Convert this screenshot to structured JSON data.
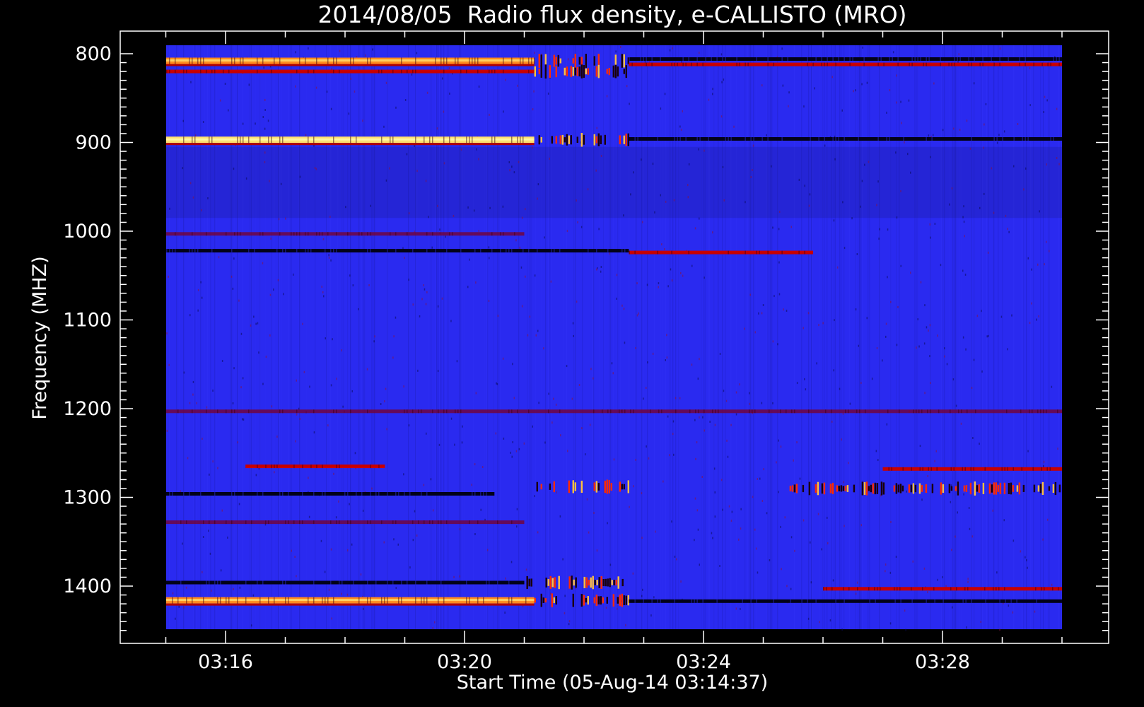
{
  "chart_data": {
    "type": "heatmap",
    "title": "2014/08/05  Radio flux density, e-CALLISTO (MRO)",
    "xlabel": "Start Time (05-Aug-14 03:14:37)",
    "ylabel": "Frequency (MHZ)",
    "x_axis": {
      "unit": "UT time",
      "range": [
        "03:14:37",
        "03:30:00"
      ],
      "major_ticks": [
        "03:16",
        "03:20",
        "03:24",
        "03:28"
      ],
      "minor_tick_step_minutes": 1
    },
    "y_axis": {
      "unit": "MHz",
      "range": [
        1450,
        795
      ],
      "inverted": true,
      "major_ticks": [
        "800",
        "900",
        "1000",
        "1100",
        "1200",
        "1300",
        "1400"
      ],
      "minor_tick_step": 10
    },
    "background_intensity": "low (blue)",
    "colormap": [
      "#000000",
      "#4a0010",
      "#b40000",
      "#ff3000",
      "#ff9a20",
      "#ffe070",
      "#2a2af0"
    ],
    "bands": [
      {
        "freq_mhz": 808,
        "t_start": "03:14:37",
        "t_end": "03:21:10",
        "level": 3
      },
      {
        "freq_mhz": 808,
        "t_start": "03:21:10",
        "t_end": "03:22:45",
        "level": 2
      },
      {
        "freq_mhz": 806,
        "t_start": "03:22:45",
        "t_end": "03:30:00",
        "level": -1
      },
      {
        "freq_mhz": 820,
        "t_start": "03:14:37",
        "t_end": "03:21:10",
        "level": 1
      },
      {
        "freq_mhz": 820,
        "t_start": "03:21:10",
        "t_end": "03:22:45",
        "level": 2
      },
      {
        "freq_mhz": 812,
        "t_start": "03:22:45",
        "t_end": "03:30:00",
        "level": 1
      },
      {
        "freq_mhz": 897,
        "t_start": "03:14:37",
        "t_end": "03:21:10",
        "level": 4
      },
      {
        "freq_mhz": 897,
        "t_start": "03:21:10",
        "t_end": "03:22:45",
        "level": 2
      },
      {
        "freq_mhz": 896,
        "t_start": "03:22:45",
        "t_end": "03:30:00",
        "level": -1
      },
      {
        "freq_mhz": 1003,
        "t_start": "03:14:37",
        "t_end": "03:21:00",
        "level": 0.5
      },
      {
        "freq_mhz": 1022,
        "t_start": "03:14:37",
        "t_end": "03:22:45",
        "level": -1
      },
      {
        "freq_mhz": 1024,
        "t_start": "03:22:45",
        "t_end": "03:25:50",
        "level": 1
      },
      {
        "freq_mhz": 1203,
        "t_start": "03:14:37",
        "t_end": "03:30:00",
        "level": 0.6
      },
      {
        "freq_mhz": 1265,
        "t_start": "03:16:20",
        "t_end": "03:18:40",
        "level": 1
      },
      {
        "freq_mhz": 1268,
        "t_start": "03:27:00",
        "t_end": "03:30:00",
        "level": 1
      },
      {
        "freq_mhz": 1288,
        "t_start": "03:21:10",
        "t_end": "03:22:45",
        "level": 2
      },
      {
        "freq_mhz": 1290,
        "t_start": "03:25:20",
        "t_end": "03:30:00",
        "level": 2
      },
      {
        "freq_mhz": 1296,
        "t_start": "03:14:37",
        "t_end": "03:20:30",
        "level": -1
      },
      {
        "freq_mhz": 1328,
        "t_start": "03:14:37",
        "t_end": "03:21:00",
        "level": 0.6
      },
      {
        "freq_mhz": 1396,
        "t_start": "03:14:37",
        "t_end": "03:21:00",
        "level": -1
      },
      {
        "freq_mhz": 1396,
        "t_start": "03:21:00",
        "t_end": "03:22:40",
        "level": 2
      },
      {
        "freq_mhz": 1403,
        "t_start": "03:26:00",
        "t_end": "03:30:00",
        "level": 1.6
      },
      {
        "freq_mhz": 1416,
        "t_start": "03:14:37",
        "t_end": "03:21:10",
        "level": 3
      },
      {
        "freq_mhz": 1416,
        "t_start": "03:21:10",
        "t_end": "03:22:45",
        "level": 2
      },
      {
        "freq_mhz": 1417,
        "t_start": "03:22:45",
        "t_end": "03:30:00",
        "level": -1
      }
    ]
  }
}
